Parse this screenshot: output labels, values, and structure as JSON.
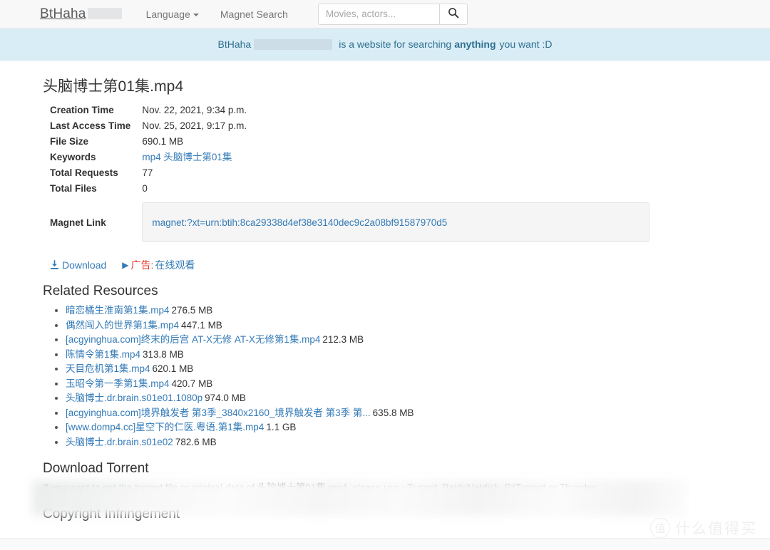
{
  "navbar": {
    "brand": "BtHaha",
    "language_label": "Language",
    "magnet_search_label": "Magnet Search",
    "search_placeholder": "Movies, actors...",
    "search_value": "",
    "search_icon": "search-icon",
    "caret_icon": "chevron-down-icon",
    "bg_color": "#f8f8f8"
  },
  "banner": {
    "brand": "BtHaha",
    "text_before": "is a website for searching",
    "text_bold": "anything",
    "text_after": "you want :D",
    "bg_color": "#d9edf7",
    "text_color": "#31708f"
  },
  "file": {
    "title": "头脑博士第01集.mp4",
    "rows": [
      {
        "label": "Creation Time",
        "value": "Nov. 22, 2021, 9:34 p.m."
      },
      {
        "label": "Last Access Time",
        "value": "Nov. 25, 2021, 9:17 p.m."
      },
      {
        "label": "File Size",
        "value": "690.1 MB"
      },
      {
        "label": "Total Requests",
        "value": "77"
      },
      {
        "label": "Total Files",
        "value": "0"
      }
    ],
    "keywords_label": "Keywords",
    "keywords": [
      "mp4",
      "头脑博士第01集"
    ],
    "magnet_label": "Magnet Link",
    "magnet_link": "magnet:?xt=urn:btih:8ca29338d4ef38e3140dec9c2a08bf91587970d5"
  },
  "actions": {
    "download_label": "Download",
    "download_icon": "download-icon",
    "ad_play_icon": "play-icon",
    "ad_tag": "广告:",
    "ad_label": "在线观看",
    "ad_tag_color": "#e8382a",
    "link_color": "#337ab7"
  },
  "related": {
    "heading": "Related Resources",
    "items": [
      {
        "name": "暗恋橘生淮南第1集.mp4",
        "size": "276.5 MB"
      },
      {
        "name": "偶然闯入的世界第1集.mp4",
        "size": "447.1 MB"
      },
      {
        "name": "[acgyinghua.com]终末的后宫 AT-X无修 AT-X无修第1集.mp4",
        "size": "212.3 MB"
      },
      {
        "name": "陈情令第1集.mp4",
        "size": "313.8 MB"
      },
      {
        "name": "天目危机第1集.mp4",
        "size": "620.1 MB"
      },
      {
        "name": "玉昭令第一季第1集.mp4",
        "size": "420.7 MB"
      },
      {
        "name": "头脑博士.dr.brain.s01e01.1080p",
        "size": "974.0 MB"
      },
      {
        "name": "[acgyinghua.com]境界触发者 第3季_3840x2160_境界触发者 第3季 第...",
        "size": "635.8 MB"
      },
      {
        "name": "[www.domp4.cc]星空下的仁医.粤语.第1集.mp4",
        "size": "1.1 GB"
      },
      {
        "name": "头脑博士.dr.brain.s01e02",
        "size": "782.6 MB"
      }
    ]
  },
  "download_torrent": {
    "heading": "Download Torrent",
    "paragraph": "If you want to get the torrent file or original data of 头脑博士第01集.mp4, please use uTorrent, BaiduNetdisk, BitTorrent or Thunder."
  },
  "copyright": {
    "heading": "Copyright Infringement"
  },
  "watermark": {
    "badge": "值",
    "text": "什么值得买"
  }
}
